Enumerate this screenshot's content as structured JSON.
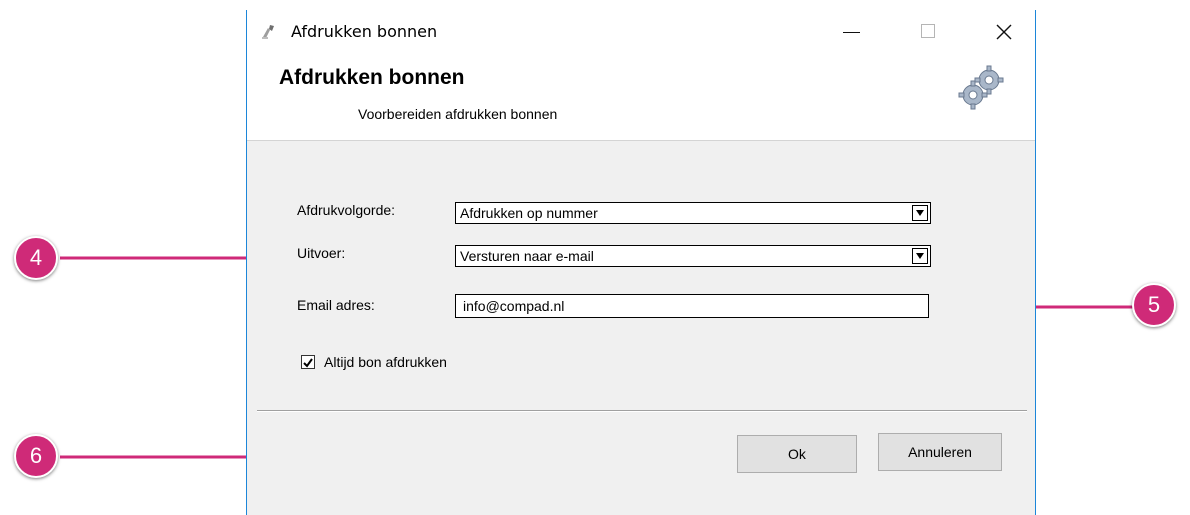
{
  "window": {
    "title": "Afdrukken bonnen",
    "header_title": "Afdrukken bonnen",
    "header_subtitle": "Voorbereiden afdrukken bonnen",
    "title_icon": "printer-icon",
    "header_icon": "gear-icon"
  },
  "form": {
    "print_order": {
      "label": "Afdrukvolgorde:",
      "value": "Afdrukken op nummer"
    },
    "output": {
      "label": "Uitvoer:",
      "value": "Versturen naar e-mail"
    },
    "email": {
      "label": "Email adres:",
      "value": "info@compad.nl"
    },
    "always_print": {
      "label": "Altijd bon afdrukken",
      "checked": true
    }
  },
  "buttons": {
    "ok": "Ok",
    "cancel": "Annuleren"
  },
  "callouts": [
    {
      "number": "4"
    },
    {
      "number": "5"
    },
    {
      "number": "6"
    }
  ],
  "colors": {
    "callout": "#cf2a78",
    "window_border": "#1c86d9",
    "dialog_bg": "#f0f0f0"
  }
}
